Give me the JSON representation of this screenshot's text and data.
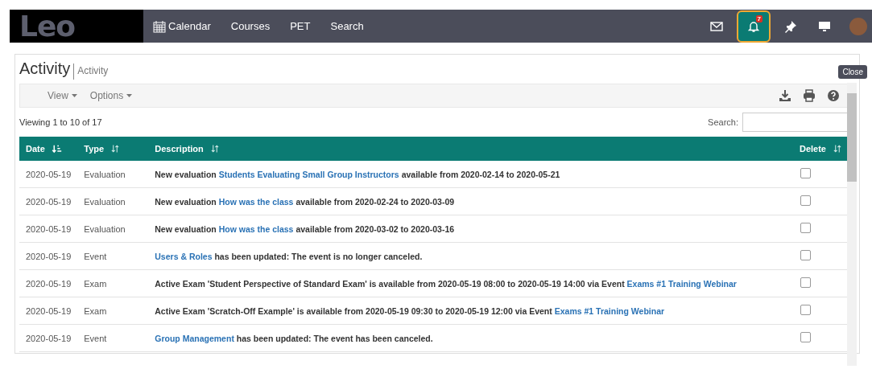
{
  "navbar": {
    "logo": "Leo",
    "items": [
      {
        "kind": "calendar",
        "label": "Calendar"
      },
      {
        "kind": "plain",
        "label": "Courses"
      },
      {
        "kind": "plain",
        "label": "PET"
      },
      {
        "kind": "plain",
        "label": "Search"
      }
    ],
    "tray": [
      {
        "kind": "mail",
        "selected": false
      },
      {
        "kind": "bell",
        "selected": true,
        "badge": "7"
      },
      {
        "kind": "pin",
        "selected": false
      },
      {
        "kind": "monitor",
        "selected": false
      },
      {
        "kind": "avatar",
        "selected": false
      }
    ]
  },
  "page": {
    "title": "Activity",
    "subtitle": "Activity",
    "tooltip": "Close",
    "menus": [
      "View",
      "Options"
    ],
    "viewing": "Viewing 1 to 10 of 17",
    "search_label": "Search:",
    "table": {
      "columns": [
        {
          "label": "Date",
          "sorted": true
        },
        {
          "label": "Type",
          "sorted": false
        },
        {
          "label": "Description",
          "sorted": false
        },
        {
          "label": "Delete",
          "sorted": false
        }
      ],
      "rows": [
        {
          "date": "2020-05-19",
          "type": "Evaluation",
          "checked": false,
          "description": [
            {
              "text": "New evaluation",
              "link": false
            },
            {
              "text": "Students Evaluating Small Group Instructors",
              "link": true
            },
            {
              "text": "available from 2020-02-14 to 2020-05-21",
              "link": false
            }
          ]
        },
        {
          "date": "2020-05-19",
          "type": "Evaluation",
          "checked": false,
          "description": [
            {
              "text": "New evaluation",
              "link": false
            },
            {
              "text": "How was the class",
              "link": true
            },
            {
              "text": "available from 2020-02-24 to 2020-03-09",
              "link": false
            }
          ]
        },
        {
          "date": "2020-05-19",
          "type": "Evaluation",
          "checked": false,
          "description": [
            {
              "text": "New evaluation",
              "link": false
            },
            {
              "text": "How was the class",
              "link": true
            },
            {
              "text": "available from 2020-03-02 to 2020-03-16",
              "link": false
            }
          ]
        },
        {
          "date": "2020-05-19",
          "type": "Event",
          "checked": false,
          "description": [
            {
              "text": "Users & Roles",
              "link": true
            },
            {
              "text": "has been updated: The event is no longer canceled.",
              "link": false
            }
          ]
        },
        {
          "date": "2020-05-19",
          "type": "Exam",
          "checked": false,
          "description": [
            {
              "text": "Active Exam 'Student Perspective of Standard Exam' is available from 2020-05-19 08:00 to 2020-05-19 14:00 via Event",
              "link": false
            },
            {
              "text": "Exams #1 Training Webinar",
              "link": true
            }
          ]
        },
        {
          "date": "2020-05-19",
          "type": "Exam",
          "checked": false,
          "description": [
            {
              "text": "Active Exam 'Scratch-Off Example' is available from 2020-05-19 09:30 to 2020-05-19 12:00 via Event",
              "link": false
            },
            {
              "text": "Exams #1 Training Webinar",
              "link": true
            }
          ]
        },
        {
          "date": "2020-05-19",
          "type": "Event",
          "checked": false,
          "description": [
            {
              "text": "Group Management",
              "link": true
            },
            {
              "text": "has been updated: The event has been canceled.",
              "link": false
            }
          ]
        }
      ]
    }
  }
}
